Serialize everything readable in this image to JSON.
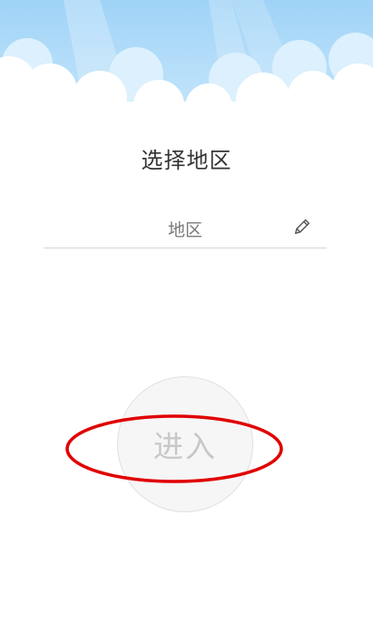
{
  "header": {
    "decoration": "sky-clouds",
    "sky_color": "#A8D8F8",
    "cloud_color": "#FFFFFF"
  },
  "page": {
    "title": "选择地区"
  },
  "region_field": {
    "value": "地区",
    "icon": "pencil-icon"
  },
  "enter_button": {
    "label": "进入"
  },
  "annotation": {
    "type": "ellipse",
    "color": "#E00000",
    "target": "enter-button"
  }
}
